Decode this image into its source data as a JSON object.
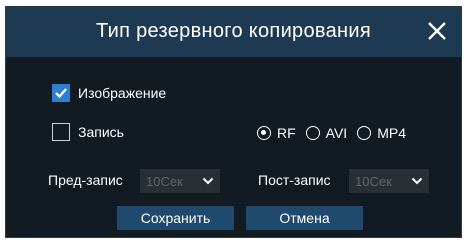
{
  "dialog": {
    "title": "Тип резервного копирования",
    "close_icon": "close-icon"
  },
  "options": {
    "image_label": "Изображение",
    "image_checked": true,
    "record_label": "Запись",
    "record_checked": false
  },
  "formats": [
    {
      "label": "RF",
      "selected": true
    },
    {
      "label": "AVI",
      "selected": false
    },
    {
      "label": "MP4",
      "selected": false
    }
  ],
  "pre_record": {
    "label": "Пред-запис",
    "value": "10Сек"
  },
  "post_record": {
    "label": "Пост-запис",
    "value": "10Сек"
  },
  "buttons": {
    "save": "Сохранить",
    "cancel": "Отмена"
  },
  "colors": {
    "accent": "#2f7fd1",
    "title_bar": "#1e3a52",
    "panel": "#121a22",
    "button": "#1f4a6e"
  }
}
